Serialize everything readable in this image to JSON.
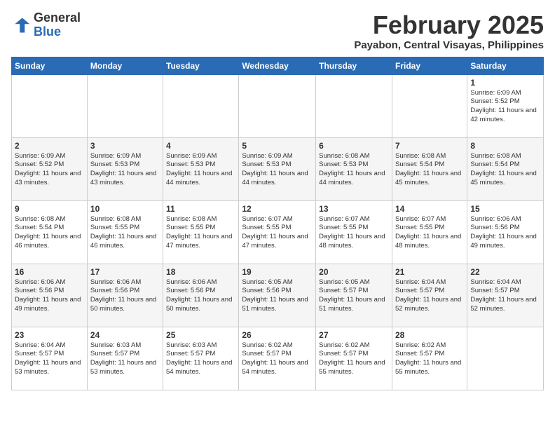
{
  "logo": {
    "general": "General",
    "blue": "Blue"
  },
  "header": {
    "month_title": "February 2025",
    "location": "Payabon, Central Visayas, Philippines"
  },
  "weekdays": [
    "Sunday",
    "Monday",
    "Tuesday",
    "Wednesday",
    "Thursday",
    "Friday",
    "Saturday"
  ],
  "weeks": [
    [
      {
        "day": "",
        "sunrise": "",
        "sunset": "",
        "daylight": ""
      },
      {
        "day": "",
        "sunrise": "",
        "sunset": "",
        "daylight": ""
      },
      {
        "day": "",
        "sunrise": "",
        "sunset": "",
        "daylight": ""
      },
      {
        "day": "",
        "sunrise": "",
        "sunset": "",
        "daylight": ""
      },
      {
        "day": "",
        "sunrise": "",
        "sunset": "",
        "daylight": ""
      },
      {
        "day": "",
        "sunrise": "",
        "sunset": "",
        "daylight": ""
      },
      {
        "day": "1",
        "sunrise": "Sunrise: 6:09 AM",
        "sunset": "Sunset: 5:52 PM",
        "daylight": "Daylight: 11 hours and 42 minutes."
      }
    ],
    [
      {
        "day": "2",
        "sunrise": "Sunrise: 6:09 AM",
        "sunset": "Sunset: 5:52 PM",
        "daylight": "Daylight: 11 hours and 43 minutes."
      },
      {
        "day": "3",
        "sunrise": "Sunrise: 6:09 AM",
        "sunset": "Sunset: 5:53 PM",
        "daylight": "Daylight: 11 hours and 43 minutes."
      },
      {
        "day": "4",
        "sunrise": "Sunrise: 6:09 AM",
        "sunset": "Sunset: 5:53 PM",
        "daylight": "Daylight: 11 hours and 44 minutes."
      },
      {
        "day": "5",
        "sunrise": "Sunrise: 6:09 AM",
        "sunset": "Sunset: 5:53 PM",
        "daylight": "Daylight: 11 hours and 44 minutes."
      },
      {
        "day": "6",
        "sunrise": "Sunrise: 6:08 AM",
        "sunset": "Sunset: 5:53 PM",
        "daylight": "Daylight: 11 hours and 44 minutes."
      },
      {
        "day": "7",
        "sunrise": "Sunrise: 6:08 AM",
        "sunset": "Sunset: 5:54 PM",
        "daylight": "Daylight: 11 hours and 45 minutes."
      },
      {
        "day": "8",
        "sunrise": "Sunrise: 6:08 AM",
        "sunset": "Sunset: 5:54 PM",
        "daylight": "Daylight: 11 hours and 45 minutes."
      }
    ],
    [
      {
        "day": "9",
        "sunrise": "Sunrise: 6:08 AM",
        "sunset": "Sunset: 5:54 PM",
        "daylight": "Daylight: 11 hours and 46 minutes."
      },
      {
        "day": "10",
        "sunrise": "Sunrise: 6:08 AM",
        "sunset": "Sunset: 5:55 PM",
        "daylight": "Daylight: 11 hours and 46 minutes."
      },
      {
        "day": "11",
        "sunrise": "Sunrise: 6:08 AM",
        "sunset": "Sunset: 5:55 PM",
        "daylight": "Daylight: 11 hours and 47 minutes."
      },
      {
        "day": "12",
        "sunrise": "Sunrise: 6:07 AM",
        "sunset": "Sunset: 5:55 PM",
        "daylight": "Daylight: 11 hours and 47 minutes."
      },
      {
        "day": "13",
        "sunrise": "Sunrise: 6:07 AM",
        "sunset": "Sunset: 5:55 PM",
        "daylight": "Daylight: 11 hours and 48 minutes."
      },
      {
        "day": "14",
        "sunrise": "Sunrise: 6:07 AM",
        "sunset": "Sunset: 5:55 PM",
        "daylight": "Daylight: 11 hours and 48 minutes."
      },
      {
        "day": "15",
        "sunrise": "Sunrise: 6:06 AM",
        "sunset": "Sunset: 5:56 PM",
        "daylight": "Daylight: 11 hours and 49 minutes."
      }
    ],
    [
      {
        "day": "16",
        "sunrise": "Sunrise: 6:06 AM",
        "sunset": "Sunset: 5:56 PM",
        "daylight": "Daylight: 11 hours and 49 minutes."
      },
      {
        "day": "17",
        "sunrise": "Sunrise: 6:06 AM",
        "sunset": "Sunset: 5:56 PM",
        "daylight": "Daylight: 11 hours and 50 minutes."
      },
      {
        "day": "18",
        "sunrise": "Sunrise: 6:06 AM",
        "sunset": "Sunset: 5:56 PM",
        "daylight": "Daylight: 11 hours and 50 minutes."
      },
      {
        "day": "19",
        "sunrise": "Sunrise: 6:05 AM",
        "sunset": "Sunset: 5:56 PM",
        "daylight": "Daylight: 11 hours and 51 minutes."
      },
      {
        "day": "20",
        "sunrise": "Sunrise: 6:05 AM",
        "sunset": "Sunset: 5:57 PM",
        "daylight": "Daylight: 11 hours and 51 minutes."
      },
      {
        "day": "21",
        "sunrise": "Sunrise: 6:04 AM",
        "sunset": "Sunset: 5:57 PM",
        "daylight": "Daylight: 11 hours and 52 minutes."
      },
      {
        "day": "22",
        "sunrise": "Sunrise: 6:04 AM",
        "sunset": "Sunset: 5:57 PM",
        "daylight": "Daylight: 11 hours and 52 minutes."
      }
    ],
    [
      {
        "day": "23",
        "sunrise": "Sunrise: 6:04 AM",
        "sunset": "Sunset: 5:57 PM",
        "daylight": "Daylight: 11 hours and 53 minutes."
      },
      {
        "day": "24",
        "sunrise": "Sunrise: 6:03 AM",
        "sunset": "Sunset: 5:57 PM",
        "daylight": "Daylight: 11 hours and 53 minutes."
      },
      {
        "day": "25",
        "sunrise": "Sunrise: 6:03 AM",
        "sunset": "Sunset: 5:57 PM",
        "daylight": "Daylight: 11 hours and 54 minutes."
      },
      {
        "day": "26",
        "sunrise": "Sunrise: 6:02 AM",
        "sunset": "Sunset: 5:57 PM",
        "daylight": "Daylight: 11 hours and 54 minutes."
      },
      {
        "day": "27",
        "sunrise": "Sunrise: 6:02 AM",
        "sunset": "Sunset: 5:57 PM",
        "daylight": "Daylight: 11 hours and 55 minutes."
      },
      {
        "day": "28",
        "sunrise": "Sunrise: 6:02 AM",
        "sunset": "Sunset: 5:57 PM",
        "daylight": "Daylight: 11 hours and 55 minutes."
      },
      {
        "day": "",
        "sunrise": "",
        "sunset": "",
        "daylight": ""
      }
    ]
  ]
}
